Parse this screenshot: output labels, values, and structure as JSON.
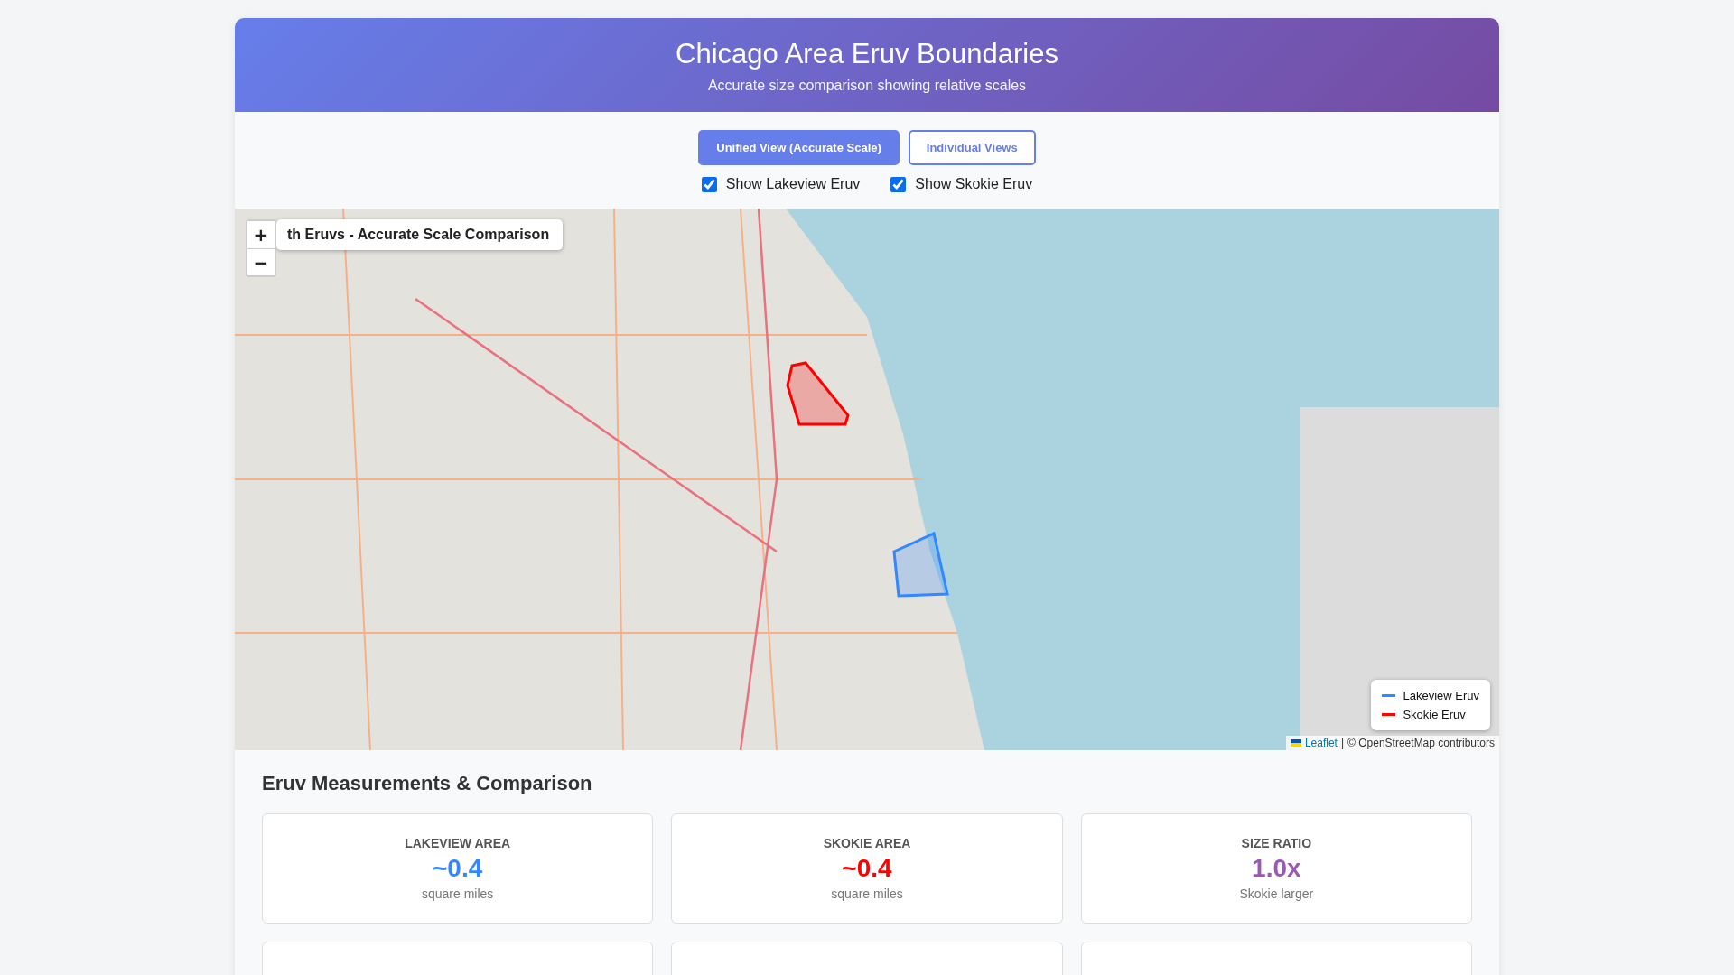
{
  "header": {
    "title": "Chicago Area Eruv Boundaries",
    "subtitle": "Accurate size comparison showing relative scales"
  },
  "view_buttons": [
    {
      "label": "Unified View (Accurate Scale)",
      "selected": true
    },
    {
      "label": "Individual Views",
      "selected": false
    }
  ],
  "toggles": [
    {
      "label": "Show Lakeview Eruv",
      "checked": true
    },
    {
      "label": "Show Skokie Eruv",
      "checked": true
    }
  ],
  "map": {
    "title": "th Eruvs - Accurate Scale Comparison",
    "zoom_in": "+",
    "zoom_out": "−",
    "boundaries": [
      {
        "kind": "lakeview",
        "color": "#3388ff",
        "visible": true
      },
      {
        "kind": "skokie",
        "color": "#ff0000",
        "visible": true
      }
    ],
    "legend": [
      {
        "label": "Lakeview Eruv",
        "color": "#3388ff"
      },
      {
        "label": "Skokie Eruv",
        "color": "#ff0000"
      }
    ],
    "attribution": {
      "link": "Leaflet",
      "separator": "|",
      "text": "© OpenStreetMap contributors"
    }
  },
  "measurements": {
    "heading": "Eruv Measurements & Comparison",
    "cards": [
      {
        "label": "LAKEVIEW AREA",
        "value": "~0.4",
        "unit": "square miles",
        "color": "#3388ff"
      },
      {
        "label": "SKOKIE AREA",
        "value": "~0.4",
        "unit": "square miles",
        "color": "#ff0000"
      },
      {
        "label": "SIZE RATIO",
        "value": "1.0x",
        "unit": "Skokie larger",
        "color": "#9b59b6"
      }
    ]
  }
}
